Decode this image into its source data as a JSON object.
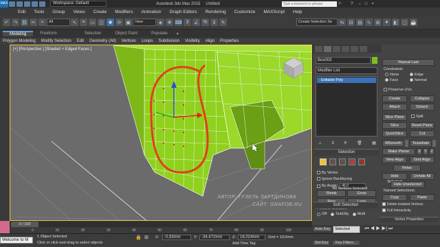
{
  "titlebar": {
    "workspace": "Workspace: Default",
    "app_title": "Autodesk 3ds Max 2015",
    "doc_title": "Untitled",
    "search_placeholder": "Type a keyword or phrase"
  },
  "menu": [
    "Edit",
    "Tools",
    "Group",
    "Views",
    "Create",
    "Modifiers",
    "Animation",
    "Graph Editors",
    "Rendering",
    "Customize",
    "MAXScript",
    "Help"
  ],
  "toolbar": {
    "filter_select": "All",
    "coord_select": "View",
    "selection_set_placeholder": "Create Selection Se"
  },
  "ribbon": {
    "tabs": [
      "Modeling",
      "Freeform",
      "Selection",
      "Object Paint",
      "Populate"
    ],
    "active_tab": "Modeling",
    "panels": [
      "Polygon Modeling",
      "Modify Selection",
      "Edit",
      "Geometry (All)",
      "Vertices",
      "Loops",
      "Subdivision",
      "Visibility",
      "Align",
      "Properties"
    ]
  },
  "viewport": {
    "label": "[+] [Perspective ] [Shaded + Edged Faces ]",
    "watermark_line1": "АВТОР: ГУЗЕЛЬ ЗАРТДИНОВА",
    "watermark_line2": "САЙТ: GRAFOB.RU"
  },
  "command_panel": {
    "object_name": "Box003",
    "modifier_list": "Modifier List",
    "stack_item": "Editable Poly",
    "selection_rollout": "Selection",
    "by_vertex": "By Vertex",
    "ignore_backfacing": "Ignore Backfacing",
    "by_angle": "By Angle:",
    "by_angle_value": "45,0",
    "shrink": "Shrink",
    "grow": "Grow",
    "ring": "Ring",
    "loop": "Loop",
    "preview_selection": "Preview Selection",
    "preview_off": "Off",
    "preview_subobj": "SubObj",
    "preview_multi": "Multi",
    "selected_count": "80 Vertices Selected",
    "soft_selection": "Soft Selection"
  },
  "right_panel": {
    "repeat_last": "Repeat Last",
    "constraints": "Constraints",
    "c_none": "None",
    "c_edge": "Edge",
    "c_face": "Face",
    "c_normal": "Normal",
    "preserve_uvs": "Preserve UVs",
    "create": "Create",
    "collapse": "Collapse",
    "attach": "Attach",
    "detach": "Detach",
    "slice_plane": "Slice Plane",
    "split": "Split",
    "slice": "Slice",
    "reset_plane": "Reset Plane",
    "quickslice": "QuickSlice",
    "cut": "Cut",
    "msmooth": "MSmooth",
    "tessellate": "Tessellate",
    "make_planar": "Make Planar",
    "x": "X",
    "y": "Y",
    "z": "Z",
    "view_align": "View Align",
    "grid_align": "Grid Align",
    "relax": "Relax",
    "hide_selected": "Hide Selected",
    "unhide_all": "Unhide All",
    "hide_unselected": "Hide Unselected",
    "named_selections": "Named Selections:",
    "copy": "Copy",
    "paste": "Paste",
    "delete_isolated": "Delete Isolated Vertices",
    "full_interactivity": "Full Interactivity",
    "vertex_properties": "Vertex Properties"
  },
  "timeline": {
    "frame_label": "0 / 100",
    "ticks": [
      "0",
      "10",
      "20",
      "30",
      "40",
      "50",
      "60",
      "70",
      "80",
      "90",
      "100"
    ]
  },
  "status": {
    "script_text": "Welcome to M",
    "selected_text": "1 Object Selected",
    "prompt_text": "Click or click-and-drag to select objects",
    "x_value": "-0,93mm",
    "y_value": "-34,472mm",
    "z_value": "16,024mm",
    "grid_text": "Grid = 10,0mm",
    "add_time_tag": "Add Time Tag",
    "auto_key": "Auto Key",
    "set_key": "Set Key",
    "key_mode": "Selected",
    "key_filters": "Key Filters..."
  },
  "colors": {
    "mesh": "#8fd11c",
    "annotation": "#e0401a",
    "accent": "#5fa0e0"
  }
}
